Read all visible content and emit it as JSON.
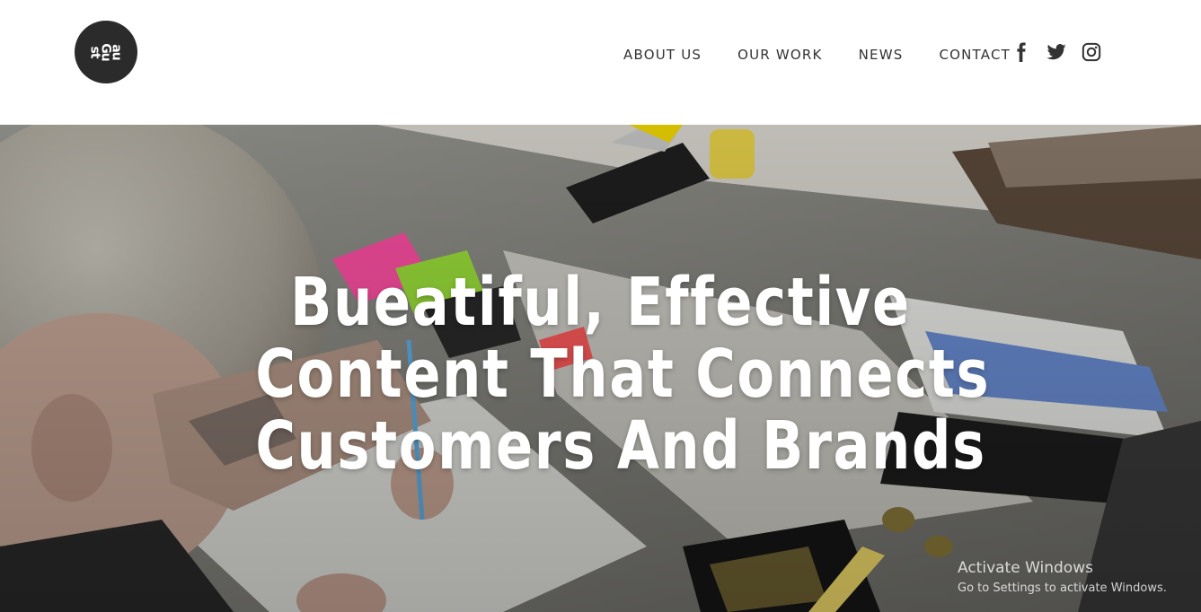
{
  "brand": {
    "logo_text": "au\nGu\nst",
    "logo_color": "#2b2b2b"
  },
  "nav": {
    "items": [
      {
        "label": "ABOUT US"
      },
      {
        "label": "OUR WORK"
      },
      {
        "label": "NEWS"
      },
      {
        "label": "CONTACT"
      }
    ]
  },
  "social": {
    "icons": [
      "facebook-icon",
      "twitter-icon",
      "instagram-icon"
    ]
  },
  "hero": {
    "title_lines": [
      "Bueatiful, Effective",
      "Content That Connects",
      "Customers And Brands"
    ]
  },
  "watermark": {
    "title": "Activate Windows",
    "subtitle": "Go to Settings to activate Windows."
  }
}
